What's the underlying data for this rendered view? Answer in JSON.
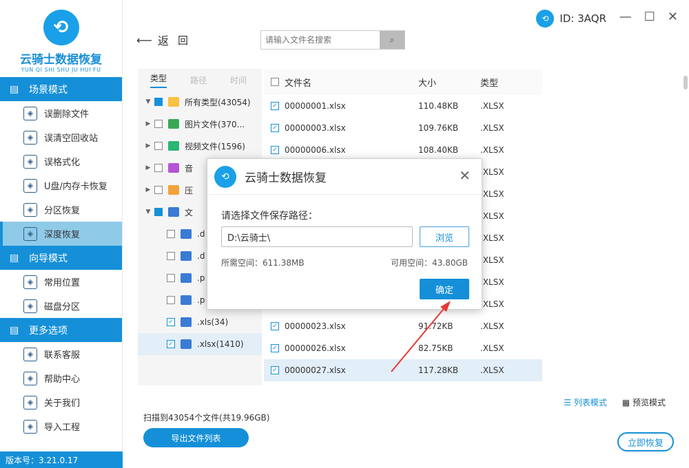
{
  "app": {
    "title": "云骑士数据恢复",
    "subtitle": "YUN QI SHI SHU JU HUI FU",
    "logo_icon": "knight-logo-icon",
    "version": "版本号：3.21.0.17",
    "id_label": "ID: 3AQR"
  },
  "sidebar": {
    "sections": [
      {
        "label": "场景模式",
        "icon": "scene-mode-icon",
        "items": [
          {
            "label": "误删除文件",
            "icon": "deleted-file-icon"
          },
          {
            "label": "误清空回收站",
            "icon": "recycle-bin-icon"
          },
          {
            "label": "误格式化",
            "icon": "format-icon"
          },
          {
            "label": "U盘/内存卡恢复",
            "icon": "usb-icon"
          },
          {
            "label": "分区恢复",
            "icon": "partition-icon"
          },
          {
            "label": "深度恢复",
            "icon": "deep-recovery-icon"
          }
        ]
      },
      {
        "label": "向导模式",
        "icon": "guide-mode-icon",
        "items": [
          {
            "label": "常用位置",
            "icon": "location-icon"
          },
          {
            "label": "磁盘分区",
            "icon": "disk-icon"
          }
        ]
      },
      {
        "label": "更多选项",
        "icon": "menu-icon",
        "items": [
          {
            "label": "联系客服",
            "icon": "support-icon"
          },
          {
            "label": "帮助中心",
            "icon": "help-icon"
          },
          {
            "label": "关于我们",
            "icon": "info-icon"
          },
          {
            "label": "导入工程",
            "icon": "import-icon"
          }
        ]
      }
    ]
  },
  "header": {
    "back_label": "返",
    "back2_label": "回",
    "search_placeholder": "请输入文件名搜索"
  },
  "tree": {
    "tabs": [
      "类型",
      "路径",
      "时间"
    ],
    "rows": [
      {
        "label": "所有类型(43054)",
        "indent": 0,
        "arrow": "▼",
        "check": "half",
        "color": "#f7c142"
      },
      {
        "label": "图片文件(370...",
        "indent": 1,
        "arrow": "▶",
        "check": "off",
        "color": "#3aa757"
      },
      {
        "label": "视频文件(1596)",
        "indent": 1,
        "arrow": "▶",
        "check": "off",
        "color": "#2bb673"
      },
      {
        "label": "音",
        "indent": 1,
        "arrow": "▶",
        "check": "off",
        "color": "#b455d6"
      },
      {
        "label": "压",
        "indent": 1,
        "arrow": "▶",
        "check": "off",
        "color": "#f2a23a"
      },
      {
        "label": "文",
        "indent": 1,
        "arrow": "▼",
        "check": "half",
        "color": "#3a7bd5"
      },
      {
        "label": ".d",
        "indent": 2,
        "arrow": "",
        "check": "off",
        "color": "#3a7bd5"
      },
      {
        "label": ".d",
        "indent": 2,
        "arrow": "",
        "check": "off",
        "color": "#3a7bd5"
      },
      {
        "label": ".p",
        "indent": 2,
        "arrow": "",
        "check": "off",
        "color": "#3a7bd5"
      },
      {
        "label": ".p",
        "indent": 2,
        "arrow": "",
        "check": "off",
        "color": "#3a7bd5"
      },
      {
        "label": ".xls(34)",
        "indent": 2,
        "arrow": "",
        "check": "on",
        "color": "#3a7bd5"
      },
      {
        "label": ".xlsx(1410)",
        "indent": 2,
        "arrow": "",
        "check": "on",
        "color": "#3a7bd5",
        "selected": true
      }
    ]
  },
  "table": {
    "headers": [
      "文件名",
      "大小",
      "类型"
    ],
    "rows": [
      {
        "name": "00000001.xlsx",
        "size": "110.48KB",
        "type": ".XLSX"
      },
      {
        "name": "00000003.xlsx",
        "size": "109.76KB",
        "type": ".XLSX"
      },
      {
        "name": "00000006.xlsx",
        "size": "108.40KB",
        "type": ".XLSX"
      },
      {
        "name": "",
        "size": "",
        "type": ".XLSX"
      },
      {
        "name": "",
        "size": "",
        "type": ".XLSX"
      },
      {
        "name": "",
        "size": "",
        "type": ".XLSX"
      },
      {
        "name": "",
        "size": "",
        "type": ".XLSX"
      },
      {
        "name": "",
        "size": "",
        "type": ".XLSX"
      },
      {
        "name": "",
        "size": "",
        "type": ".XLSX"
      },
      {
        "name": "",
        "size": "",
        "type": ".XLSX"
      },
      {
        "name": "00000023.xlsx",
        "size": "91.72KB",
        "type": ".XLSX"
      },
      {
        "name": "00000026.xlsx",
        "size": "82.75KB",
        "type": ".XLSX"
      },
      {
        "name": "00000027.xlsx",
        "size": "117.28KB",
        "type": ".XLSX",
        "selected": true
      }
    ]
  },
  "footer": {
    "scan_summary": "扫描到43054个文件(共19.96GB)",
    "export_label": "导出文件列表",
    "list_mode": "列表模式",
    "preview_mode": "预览模式",
    "recover_label": "立即恢复"
  },
  "dialog": {
    "title": "云骑士数据恢复",
    "label": "请选择文件保存路径：",
    "path": "D:\\云骑士\\",
    "browse": "浏览",
    "need": "所需空间：611.38MB",
    "available": "可用空间：43.80GB",
    "ok": "确定"
  },
  "colors": {
    "accent": "#1590d8",
    "arrow": "#e53935"
  }
}
